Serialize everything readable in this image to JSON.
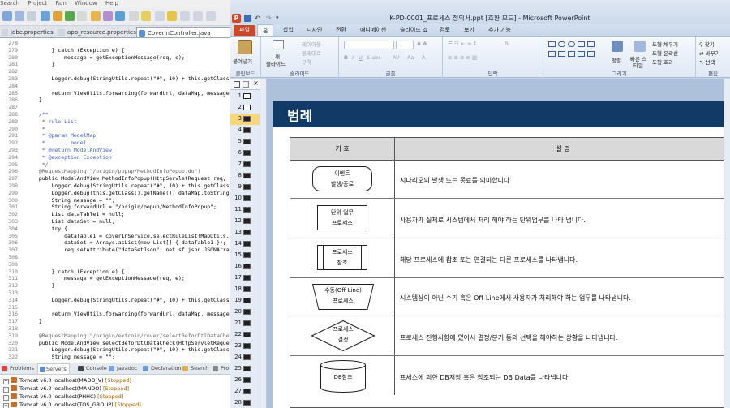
{
  "eclipse": {
    "menu": [
      "Search",
      "Project",
      "Run",
      "Window",
      "Help"
    ],
    "tabs": [
      "jdbc.properties",
      "app_resource.properties",
      "CoverInController.java"
    ],
    "line_numbers": [
      "278",
      "279",
      "280",
      "281",
      "282",
      "283",
      "284",
      "285",
      "286",
      "287",
      "288",
      "289",
      "290",
      "291",
      "292",
      "293",
      "294",
      "295",
      "296",
      "297",
      "298",
      "299",
      "300",
      "301",
      "302",
      "303",
      "304",
      "305",
      "306",
      "307",
      "308",
      "309",
      "310",
      "311",
      "312",
      "313",
      "314",
      "315",
      "316",
      "317",
      "318",
      "319",
      "320",
      "321",
      "322"
    ],
    "code": [
      "",
      "      } catch (Exception e) {",
      "          message = getExceptionMessage(req, e);",
      "      }",
      "",
      "      Logger.debug(StringUtils.repeat(\"#\", 10) + this.getClass()",
      "",
      "      return ViewUtils.forwarding(forwardUrl, dataMap, message);",
      "  }",
      "",
      "  /**",
      "   * rule List",
      "   *",
      "   * @param ModelMap",
      "   *        model",
      "   * @return ModelAndView",
      "   * @exception Exception",
      "   */",
      "  @RequestMapping(\"/origin/popup/MethodInfoPopup.do\")",
      "  public ModelAndView MethodInfoPopup(HttpServletRequest req, H",
      "      Logger.debug(StringUtils.repeat(\"#\", 10) + this.getClass()",
      "      Logger.debug(this.getClass().getName(), dataMap.toString());",
      "      String message = \"\";",
      "      String forwardUrl = \"/origin/popup/MethodInfoPopup\";",
      "      List dataTable1 = null;",
      "      List dataSet = null;",
      "      try {",
      "          dataTable1 = coverInService.selectRuleList(MapUtils.c",
      "          dataSet = Arrays.asList(new List[] { dataTable1 });",
      "          req.setAttribute(\"dataSetJson\", net.sf.json.JSONArray",
      "",
      "",
      "      } catch (Exception e) {",
      "          message = getExceptionMessage(req, e);",
      "      }",
      "",
      "      Logger.debug(StringUtils.repeat(\"#\", 10) + this.getClass()",
      "",
      "      return ViewUtils.forwarding(forwardUrl, dataMap, message);",
      "  }",
      "",
      "  @RequestMapping(\"/origin/extcoin/cover/selectBeforDtlDataChe",
      "  public ModelAndView selectBeforDtlDataCheck(HttpServletRequest",
      "      Logger.debug(StringUtils.repeat(\"#\", 10) + this.getClass()",
      "      String message = \"\";"
    ],
    "bottom_tabs": [
      "Problems",
      "Servers",
      "Console",
      "Javadoc",
      "Declaration",
      "Search",
      "Pro"
    ],
    "servers": [
      {
        "name": "Tomcat v6.0 localhost(MADO_V)",
        "status": "[Stopped]"
      },
      {
        "name": "Tomcat v6.0 localhost(MANDO)",
        "status": "[Stopped]"
      },
      {
        "name": "Tomcat v6.0 localhost(PHHC)",
        "status": "[Stopped]"
      },
      {
        "name": "Tomcat v6.0 localhost(TOS_GROUP)",
        "status": "[Stopped]"
      }
    ]
  },
  "ppt": {
    "window_title": "K-PD-0001_프로세스 정의서.ppt [호환 모드] - Microsoft PowerPoint",
    "ribbon_tabs": [
      "파일",
      "홈",
      "삽입",
      "디자인",
      "전환",
      "애니메이션",
      "슬라이드 쇼",
      "검토",
      "보기",
      "추가 기능"
    ],
    "groups": {
      "clipboard": {
        "paste": "붙여넣기",
        "label": "클립보드"
      },
      "slides": {
        "new_line1": "새",
        "new_line2": "슬라이드",
        "layout": "레이아웃",
        "reset": "원래대로",
        "section": "구역",
        "label": "슬라이드"
      },
      "font": {
        "label": "글꼴"
      },
      "paragraph": {
        "label": "단락"
      },
      "drawing": {
        "arrange": "정렬",
        "quick_styles": "빠른 스타일",
        "fill": "도형 채우기",
        "outline": "도형 윤곽선",
        "effects": "도형 효과",
        "label": "그리기"
      },
      "editing": {
        "find": "찾기",
        "replace": "바꾸기",
        "select": "선택",
        "label": "편집"
      }
    },
    "slide_numbers": [
      "1",
      "2",
      "3",
      "4",
      "5",
      "6",
      "7",
      "8",
      "9",
      "10",
      "11",
      "12",
      "13",
      "14",
      "15",
      "16",
      "17",
      "18",
      "19",
      "20",
      "21",
      "22",
      "23",
      "24",
      "25",
      "26",
      "27",
      "28"
    ],
    "slide": {
      "title": "범례",
      "header_symbol": "기  호",
      "header_desc": "설          명",
      "rows": [
        {
          "sym1": "이벤트",
          "sym2": "발생/종료",
          "desc": "시나리오의 발생 또는 종료를 의미합니다"
        },
        {
          "sym1": "단위 업무",
          "sym2": "프로세스",
          "desc": "사용자가 실제로 시스템에서 처리 해야 하는 단위업무를 나타 냅니다."
        },
        {
          "sym1": "프로세스",
          "sym2": "참조",
          "desc": "해당 프로세스에 참조 또는 연결되는 다른 프로세스를 나타냅니다."
        },
        {
          "sym1": "수동(Off-Line)",
          "sym2": "프로세스",
          "desc": "시스템상이 아닌 수기 혹은 Off-Line에서 사용자가 처리해야 하는 업무를 나타냅니다."
        },
        {
          "sym1": "프로세스",
          "sym2": "결정",
          "desc": "프로세스 진행사항에 있어서 결정/분기 등의 선택을 해야하는 상황을 나타냅니다."
        },
        {
          "sym1": "DB참조",
          "sym2": "",
          "desc": "프세스에 의한 DB저장 혹은 참조되는 DB Data를 나타냅니다."
        }
      ]
    }
  }
}
